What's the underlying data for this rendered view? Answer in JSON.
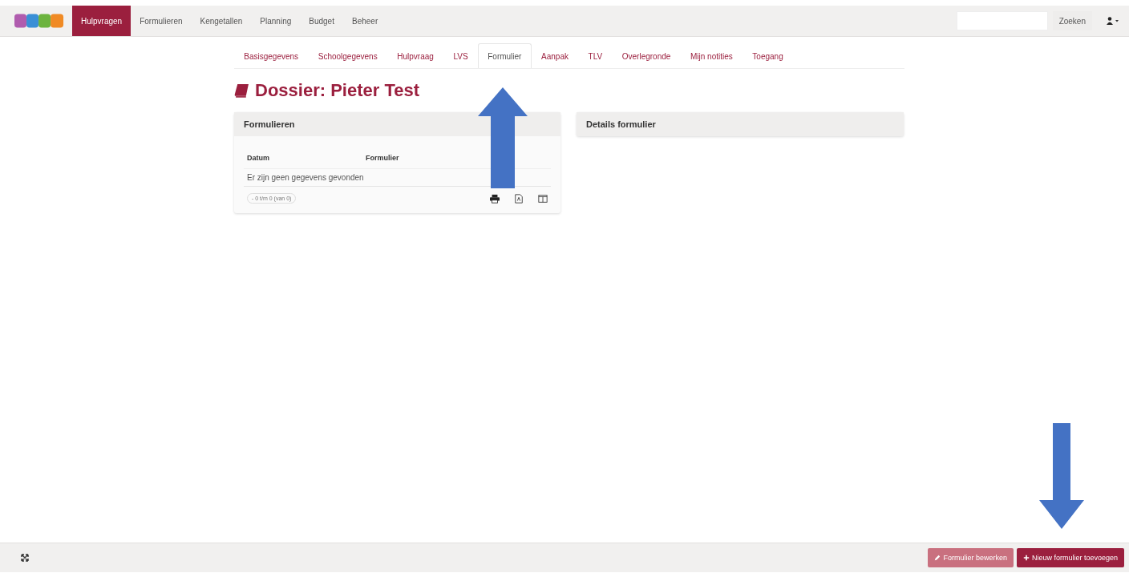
{
  "navbar": {
    "items": [
      {
        "label": "Hulpvragen",
        "selected": true
      },
      {
        "label": "Formulieren",
        "selected": false
      },
      {
        "label": "Kengetallen",
        "selected": false
      },
      {
        "label": "Planning",
        "selected": false
      },
      {
        "label": "Budget",
        "selected": false
      },
      {
        "label": "Beheer",
        "selected": false
      }
    ],
    "search_button": "Zoeken"
  },
  "tabs": [
    {
      "label": "Basisgegevens",
      "selected": false
    },
    {
      "label": "Schoolgegevens",
      "selected": false
    },
    {
      "label": "Hulpvraag",
      "selected": false
    },
    {
      "label": "LVS",
      "selected": false
    },
    {
      "label": "Formulier",
      "selected": true
    },
    {
      "label": "Aanpak",
      "selected": false
    },
    {
      "label": "TLV",
      "selected": false
    },
    {
      "label": "Overlegronde",
      "selected": false
    },
    {
      "label": "Mijn notities",
      "selected": false
    },
    {
      "label": "Toegang",
      "selected": false
    }
  ],
  "title": "Dossier: Pieter Test",
  "forms_panel": {
    "title": "Formulieren",
    "columns": [
      "Datum",
      "Formulier"
    ],
    "empty_message": "Er zijn geen gegevens gevonden",
    "pager": "- 0 t/m 0 (van 0)"
  },
  "details_panel": {
    "title": "Details formulier"
  },
  "footer": {
    "buttons": [
      {
        "label": "Formulier bewerken",
        "kind": "edit",
        "disabled": true
      },
      {
        "label": "Nieuw formulier toevoegen",
        "kind": "add",
        "disabled": false
      }
    ]
  }
}
